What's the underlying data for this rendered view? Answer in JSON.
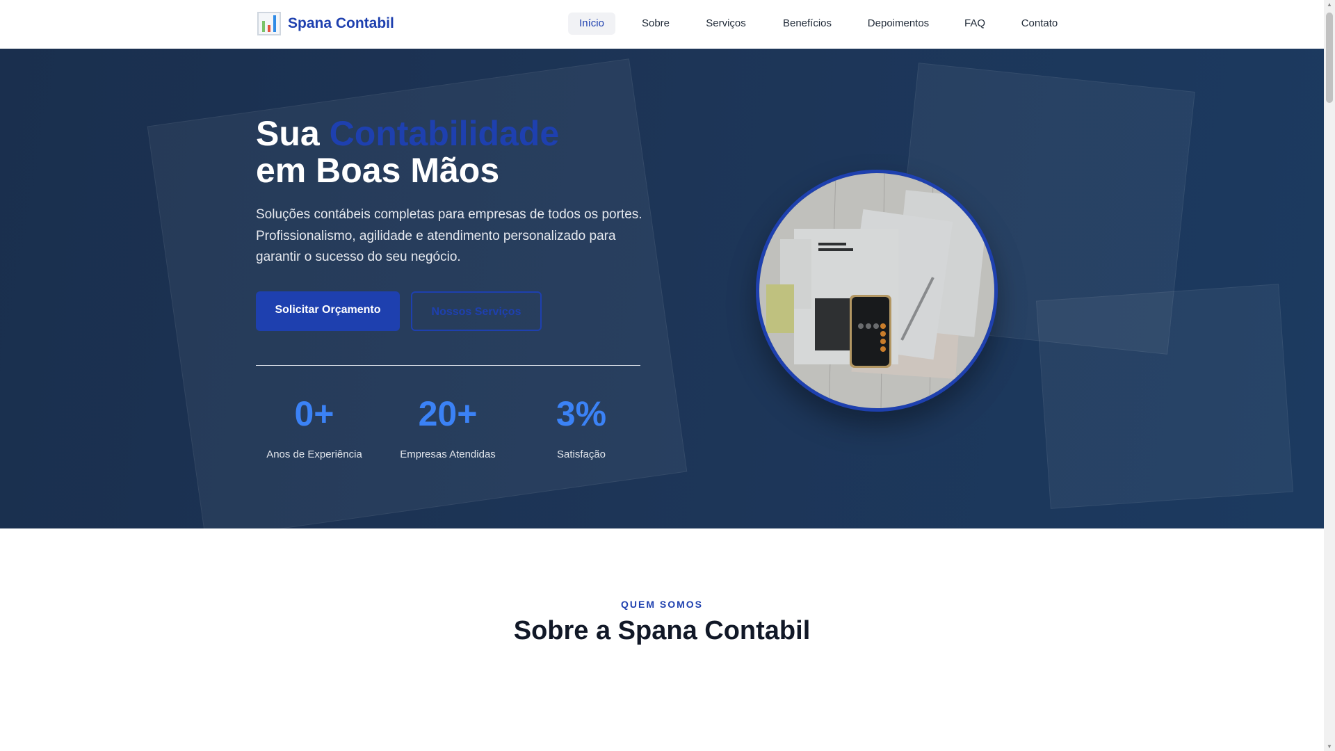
{
  "nav": {
    "brand": "Spana Contabil",
    "items": [
      {
        "label": "Início",
        "active": true
      },
      {
        "label": "Sobre"
      },
      {
        "label": "Serviços"
      },
      {
        "label": "Benefícios"
      },
      {
        "label": "Depoimentos"
      },
      {
        "label": "FAQ"
      },
      {
        "label": "Contato"
      }
    ]
  },
  "hero": {
    "title_part1": "Sua ",
    "title_accent": "Contabilidade",
    "title_line2": "em Boas Mãos",
    "lead": "Soluções contábeis completas para empresas de todos os portes. Profissionalismo, agilidade e atendimento personalizado para garantir o sucesso do seu negócio.",
    "primary_button": "Solicitar Orçamento",
    "secondary_button": "Nossos Serviços",
    "stats": [
      {
        "value": "0+",
        "label": "Anos de Experiência"
      },
      {
        "value": "20+",
        "label": "Empresas Atendidas"
      },
      {
        "value": "3%",
        "label": "Satisfação"
      }
    ]
  },
  "about": {
    "eyebrow": "QUEM SOMOS",
    "title": "Sobre a Spana Contabil"
  },
  "colors": {
    "brand": "#1e40af",
    "stat": "#3b82f6",
    "hero_bg": "#1d3557"
  }
}
